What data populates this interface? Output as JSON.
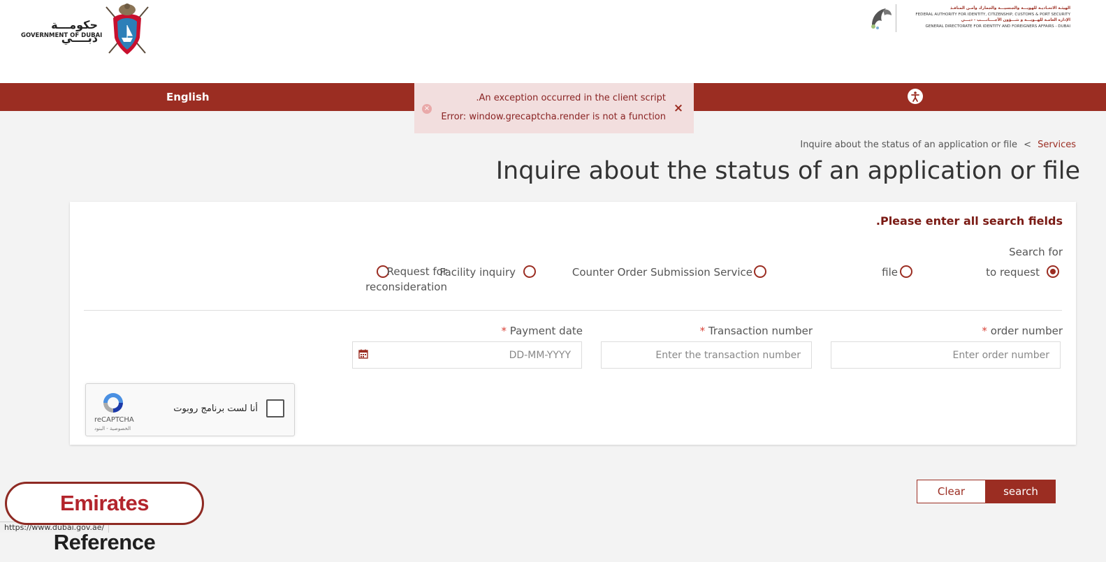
{
  "header": {
    "gov_logo_ar": "حكومـــة دبــــي",
    "gov_logo_en": "GOVERNMENT OF DUBAI",
    "ica_logo_lines": [
      "الهيئـة الاتحـاديـة للهويـــة والجنسيـــة والجمارك وأمـن المنافـذ",
      "FEDERAL AUTHORITY FOR IDENTITY, CITIZENSHIP, CUSTOMS & PORT SECURITY",
      "الإدارة العامـة للهــويـــة و شـــؤون الأجــــانــــب - دبـــي",
      "GENERAL DIRECTORATE FOR IDENTITY AND FOREIGNERS AFFAIRS - DUBAI"
    ]
  },
  "nav": {
    "language_link": "English",
    "accessibility_icon": "accessibility-icon"
  },
  "toast": {
    "line1": ".An exception occurred in the client script",
    "line2": "Error: window.grecaptcha.render is not a function",
    "close_glyph": "×",
    "error_glyph": "×"
  },
  "breadcrumb": {
    "services": "Services",
    "separator": "<",
    "current": "Inquire about the status of an application or file"
  },
  "page": {
    "title": "Inquire about the status of an application or file"
  },
  "form": {
    "warning": ".Please enter all search fields",
    "search_for_label": "Search for",
    "options": [
      {
        "label": "to request",
        "selected": true
      },
      {
        "label": "file",
        "selected": false
      },
      {
        "label": "Counter Order Submission Service",
        "selected": false
      },
      {
        "label": "Facility inquiry",
        "selected": false
      },
      {
        "label": "Request for reconsideration",
        "selected": false
      }
    ],
    "option_reconsideration_line1": "Request for",
    "option_reconsideration_line2": "reconsideration",
    "required_mark": "*",
    "fields": {
      "order_number": {
        "label": "order number",
        "placeholder": "Enter order number",
        "value": ""
      },
      "transaction_number": {
        "label": "Transaction number",
        "placeholder": "Enter the transaction number",
        "value": ""
      },
      "payment_date": {
        "label": "Payment date",
        "placeholder": "DD-MM-YYYY",
        "value": ""
      }
    },
    "captcha": {
      "label": "أنا لست برنامج روبوت",
      "brand": "reCAPTCHA",
      "terms": "الخصوصية - البنود"
    },
    "buttons": {
      "search": "search",
      "clear": "Clear"
    }
  },
  "watermark": {
    "word1": "Emirates",
    "word2": "Reference"
  },
  "status_bar": {
    "url": "https://www.dubai.gov.ae/"
  },
  "colors": {
    "brand": "#9b2d22",
    "warning_text": "#7a1a14",
    "required": "#d9443a",
    "toast_bg": "#f2dede",
    "page_bg": "#f3f3f3"
  }
}
